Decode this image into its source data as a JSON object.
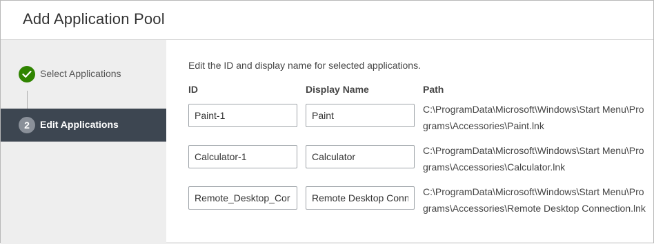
{
  "dialog": {
    "title": "Add Application Pool"
  },
  "sidebar": {
    "steps": [
      {
        "number": "",
        "label": "Select Applications",
        "status": "completed",
        "icon": "check-icon"
      },
      {
        "number": "2",
        "label": "Edit Applications",
        "status": "active"
      }
    ]
  },
  "main": {
    "intro": "Edit the ID and display name for selected applications.",
    "columns": {
      "id": "ID",
      "display_name": "Display Name",
      "path": "Path"
    },
    "rows": [
      {
        "id": "Paint-1",
        "display_name": "Paint",
        "path": "C:\\ProgramData\\Microsoft\\Windows\\Start Menu\\Programs\\Accessories\\Paint.lnk"
      },
      {
        "id": "Calculator-1",
        "display_name": "Calculator",
        "path": "C:\\ProgramData\\Microsoft\\Windows\\Start Menu\\Programs\\Accessories\\Calculator.lnk"
      },
      {
        "id": "Remote_Desktop_Cor",
        "display_name": "Remote Desktop Conn",
        "path": "C:\\ProgramData\\Microsoft\\Windows\\Start Menu\\Programs\\Accessories\\Remote Desktop Connection.lnk"
      }
    ]
  },
  "colors": {
    "active_step_bg": "#3d4651",
    "completed_step": "#2f8400",
    "sidebar_bg": "#eeeeee"
  }
}
